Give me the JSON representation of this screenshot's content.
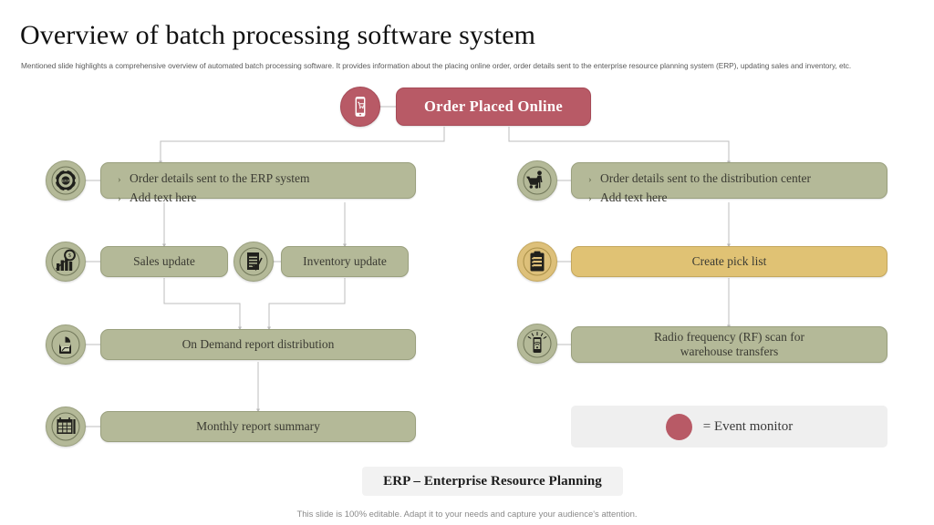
{
  "header": {
    "title": "Overview of batch processing software system",
    "subtitle": "Mentioned slide highlights a comprehensive overview of automated batch processing software. It provides information about the placing online order, order details sent to the enterprise resource planning system (ERP), updating sales and inventory, etc."
  },
  "flow": {
    "root": {
      "label": "Order Placed Online",
      "icon": "mobile-shopping-cart-icon",
      "color": "#b85a66"
    },
    "left_branch": [
      {
        "id": "erp-node",
        "icon": "erp-gear-icon",
        "color": "#b4b998",
        "bullets": [
          "Order details sent to the ERP system",
          "Add text here"
        ]
      },
      {
        "id": "sales-update-node",
        "label": "Sales update",
        "icon": "sales-chart-icon",
        "color": "#b4b998"
      },
      {
        "id": "inventory-update-node",
        "label": "Inventory update",
        "icon": "inventory-document-icon",
        "color": "#b4b998"
      },
      {
        "id": "on-demand-report-node",
        "label": "On Demand report distribution",
        "icon": "report-clipboard-icon",
        "color": "#b4b998"
      },
      {
        "id": "monthly-report-node",
        "label": "Monthly report summary",
        "icon": "calendar-table-icon",
        "color": "#b4b998"
      }
    ],
    "right_branch": [
      {
        "id": "distribution-center-node",
        "icon": "worker-cart-icon",
        "color": "#b4b998",
        "bullets": [
          "Order details sent to the distribution center",
          "Add text here"
        ]
      },
      {
        "id": "pick-list-node",
        "label": "Create pick list",
        "icon": "pick-list-clipboard-icon",
        "color": "#e0c274"
      },
      {
        "id": "rf-scan-node",
        "label": "Radio frequency (RF) scan for\nwarehouse transfers",
        "line1": "Radio frequency (RF) scan for",
        "line2": "warehouse transfers",
        "icon": "rf-scanner-icon",
        "color": "#b4b998"
      }
    ]
  },
  "legend": {
    "marker_color": "#b85a66",
    "text": "= Event monitor"
  },
  "footnote": {
    "erp_expansion": "ERP – Enterprise Resource Planning",
    "editable_note": "This slide is 100% editable. Adapt it to your needs and capture your audience's attention."
  }
}
